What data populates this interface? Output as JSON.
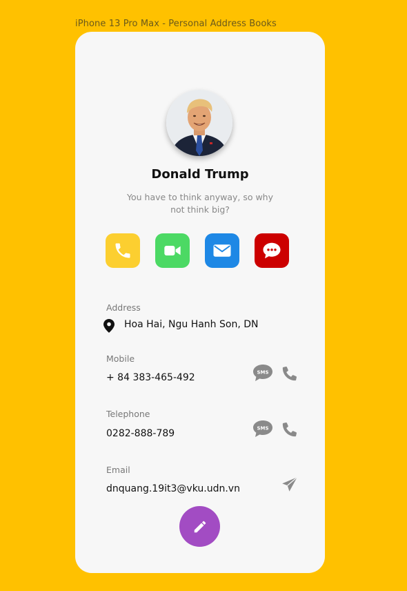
{
  "frame": {
    "label": "iPhone 13 Pro Max - Personal Address Books"
  },
  "colors": {
    "background": "#FFC100",
    "card": "#F7F7F7",
    "call": "#FCCF30",
    "video": "#4CD964",
    "mail": "#1E88E5",
    "message": "#CC0000",
    "fab": "#A24CC3",
    "icon_gray": "#888888"
  },
  "profile": {
    "name": "Donald Trump",
    "quote": "You have to think anyway, so why not think big?",
    "avatar": "profile-photo"
  },
  "actions": [
    {
      "icon": "phone-icon"
    },
    {
      "icon": "video-camera-icon"
    },
    {
      "icon": "envelope-icon"
    },
    {
      "icon": "chat-bubble-icon"
    }
  ],
  "fields": {
    "address": {
      "label": "Address",
      "value": "Hoa Hai, Ngu Hanh Son, DN",
      "icon": "location-pin-icon"
    },
    "mobile": {
      "label": "Mobile",
      "value": "+ 84 383-465-492",
      "sms_icon": "sms-icon",
      "call_icon": "phone-icon"
    },
    "telephone": {
      "label": "Telephone",
      "value": "0282-888-789",
      "sms_icon": "sms-icon",
      "call_icon": "phone-icon"
    },
    "email": {
      "label": "Email",
      "value": "dnquang.19it3@vku.udn.vn",
      "send_icon": "paper-plane-icon"
    }
  },
  "fab": {
    "icon": "pencil-icon"
  },
  "sms_glyph": "SMS"
}
